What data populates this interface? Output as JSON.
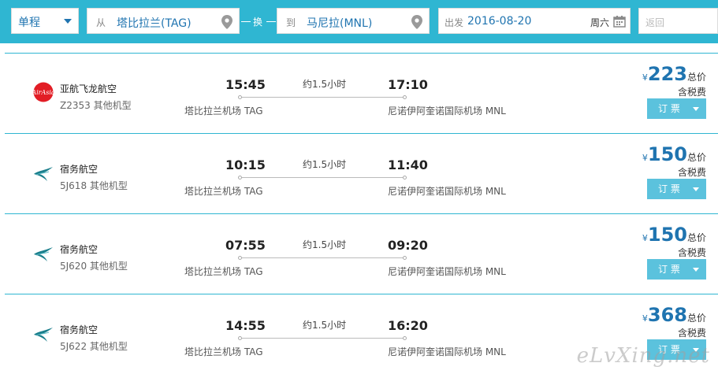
{
  "search": {
    "trip_type": "单程",
    "from_prefix": "从",
    "from_city": "塔比拉兰(TAG)",
    "swap_label": "换",
    "to_prefix": "到",
    "to_city": "马尼拉(MNL)",
    "date_prefix": "出发",
    "date_value": "2016-08-20",
    "day_of_week": "周六",
    "return_placeholder": "返回"
  },
  "flights": [
    {
      "airline": "亚航飞龙航空",
      "logo": "airasia-logo",
      "flight_no": "Z2353 其他机型",
      "dep_time": "15:45",
      "arr_time": "17:10",
      "duration": "约1.5小时",
      "dep_airport": "塔比拉兰机场 TAG",
      "arr_airport": "尼诺伊阿奎诺国际机场 MNL",
      "currency": "¥",
      "price": "223",
      "price_label": "总价",
      "tax_label": "含税费",
      "book_label": "订 票"
    },
    {
      "airline": "宿务航空",
      "logo": "cebu-pacific-logo",
      "flight_no": "5J618 其他机型",
      "dep_time": "10:15",
      "arr_time": "11:40",
      "duration": "约1.5小时",
      "dep_airport": "塔比拉兰机场 TAG",
      "arr_airport": "尼诺伊阿奎诺国际机场 MNL",
      "currency": "¥",
      "price": "150",
      "price_label": "总价",
      "tax_label": "含税费",
      "book_label": "订 票"
    },
    {
      "airline": "宿务航空",
      "logo": "cebu-pacific-logo",
      "flight_no": "5J620 其他机型",
      "dep_time": "07:55",
      "arr_time": "09:20",
      "duration": "约1.5小时",
      "dep_airport": "塔比拉兰机场 TAG",
      "arr_airport": "尼诺伊阿奎诺国际机场 MNL",
      "currency": "¥",
      "price": "150",
      "price_label": "总价",
      "tax_label": "含税费",
      "book_label": "订 票"
    },
    {
      "airline": "宿务航空",
      "logo": "cebu-pacific-logo",
      "flight_no": "5J622 其他机型",
      "dep_time": "14:55",
      "arr_time": "16:20",
      "duration": "约1.5小时",
      "dep_airport": "塔比拉兰机场 TAG",
      "arr_airport": "尼诺伊阿奎诺国际机场 MNL",
      "currency": "¥",
      "price": "368",
      "price_label": "总价",
      "tax_label": "含税费",
      "book_label": "订 票"
    }
  ],
  "watermark": "eLvXing.net",
  "colors": {
    "accent": "#2fb6d2",
    "price": "#1f74b0",
    "button": "#5bc2dd"
  }
}
